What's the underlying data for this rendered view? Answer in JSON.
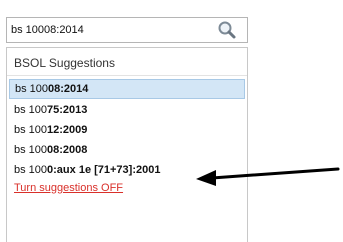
{
  "search": {
    "value": "bs 10008:2014",
    "button_icon": "magnifier-icon"
  },
  "suggestions": {
    "title": "BSOL Suggestions",
    "items": [
      {
        "prefix": "bs 100",
        "match": "08:2014",
        "selected": true
      },
      {
        "prefix": "bs 100",
        "match": "75:2013",
        "selected": false
      },
      {
        "prefix": "bs 100",
        "match": "12:2009",
        "selected": false
      },
      {
        "prefix": "bs 100",
        "match": "08:2008",
        "selected": false
      },
      {
        "prefix": "bs 100",
        "match": "0:aux 1e [71+73]:2001",
        "selected": false
      }
    ],
    "toggle_label": "Turn suggestions OFF"
  },
  "colors": {
    "selected_bg": "#d3e6f6",
    "link": "#d9302a"
  }
}
